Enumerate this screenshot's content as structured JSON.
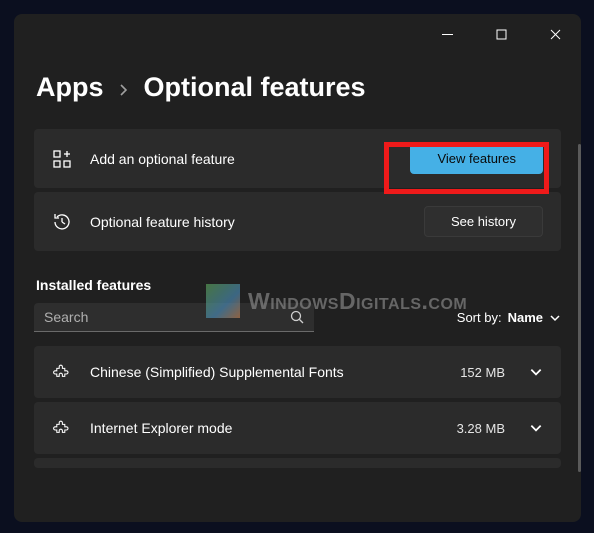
{
  "breadcrumb": {
    "parent": "Apps",
    "current": "Optional features"
  },
  "cards": {
    "add": {
      "label": "Add an optional feature",
      "button": "View features"
    },
    "history": {
      "label": "Optional feature history",
      "button": "See history"
    }
  },
  "installed_section": {
    "title": "Installed features",
    "search_placeholder": "Search",
    "sort_label": "Sort by:",
    "sort_value": "Name"
  },
  "features": [
    {
      "name": "Chinese (Simplified) Supplemental Fonts",
      "size": "152 MB"
    },
    {
      "name": "Internet Explorer mode",
      "size": "3.28 MB"
    }
  ],
  "watermark": "WindowsDigitals.com"
}
